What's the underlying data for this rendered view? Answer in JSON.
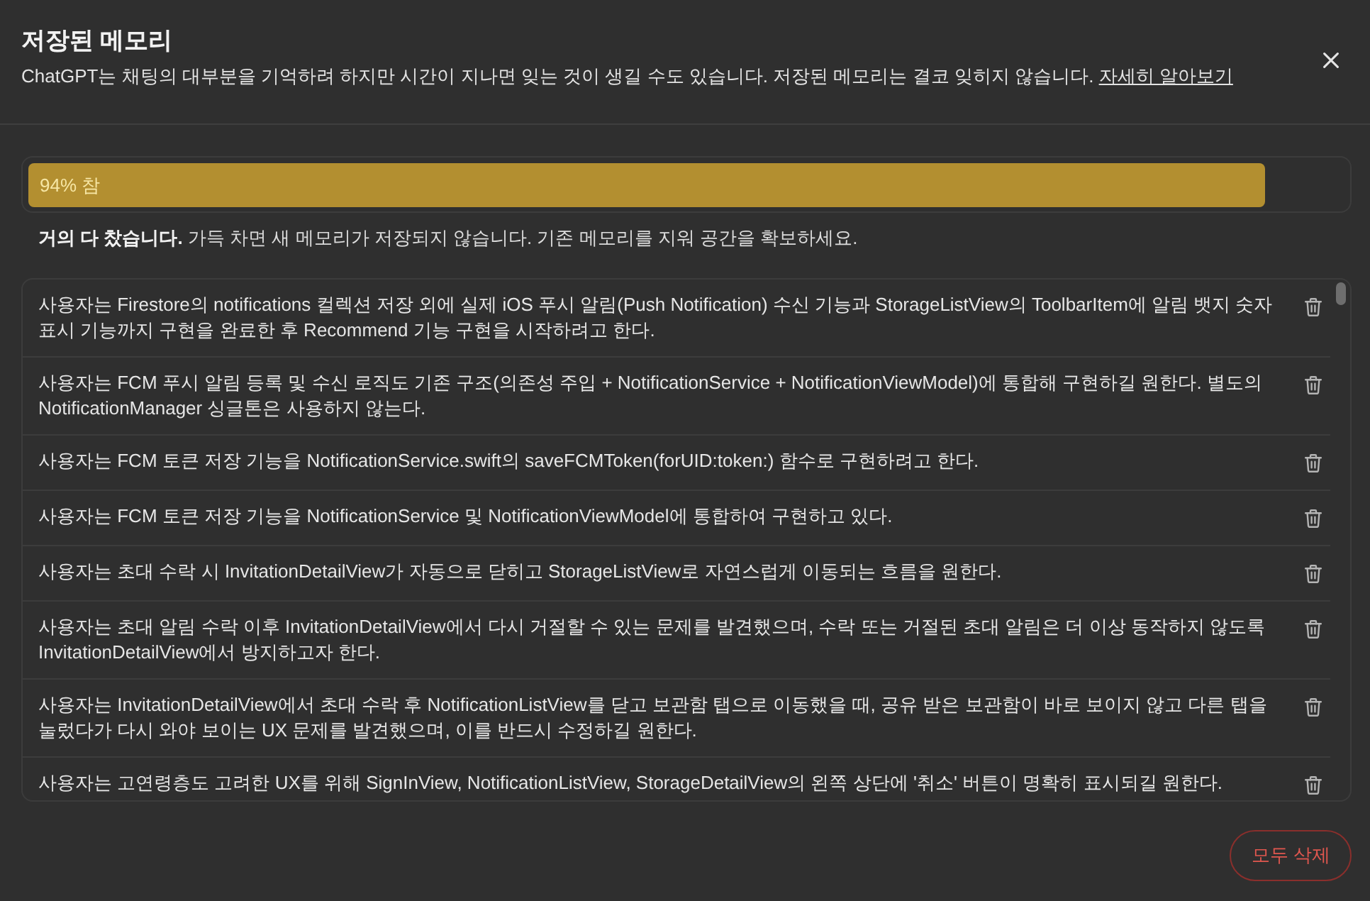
{
  "dialog": {
    "title": "저장된 메모리",
    "description": "ChatGPT는 채팅의 대부분을 기억하려 하지만 시간이 지나면 잊는 것이 생길 수도 있습니다. 저장된 메모리는 결코 잊히지 않습니다.",
    "link": "자세히 알아보기"
  },
  "usage": {
    "label": "94% 참",
    "level": 0.94,
    "note": "**거의 다 찼습니다.** 가득 차면 새 메모리가 저장되지 않습니다. 기존 메모리를 지워 공간을 확보하세요."
  },
  "memories": [
    {
      "text": "사용자는 Firestore의 notifications 컬렉션 저장 외에 실제 iOS 푸시 알림(Push Notification) 수신 기능과 StorageListView의 ToolbarItem에 알림 뱃지 숫자 표시 기능까지 구현을 완료한 후 Recommend 기능 구현을 시작하려고 한다."
    },
    {
      "text": "사용자는 FCM 푸시 알림 등록 및 수신 로직도 기존 구조(의존성 주입 + NotificationService + NotificationViewModel)에 통합해 구현하길 원한다. 별도의 NotificationManager 싱글톤은 사용하지 않는다."
    },
    {
      "text": "사용자는 FCM 토큰 저장 기능을 NotificationService.swift의 saveFCMToken(forUID:token:) 함수로 구현하려고 한다."
    },
    {
      "text": "사용자는 FCM 토큰 저장 기능을 NotificationService 및 NotificationViewModel에 통합하여 구현하고 있다."
    },
    {
      "text": "사용자는 초대 수락 시 InvitationDetailView가 자동으로 닫히고 StorageListView로 자연스럽게 이동되는 흐름을 원한다."
    },
    {
      "text": "사용자는 초대 알림 수락 이후 InvitationDetailView에서 다시 거절할 수 있는 문제를 발견했으며, 수락 또는 거절된 초대 알림은 더 이상 동작하지 않도록 InvitationDetailView에서 방지하고자 한다."
    },
    {
      "text": "사용자는 InvitationDetailView에서 초대 수락 후 NotificationListView를 닫고 보관함 탭으로 이동했을 때, 공유 받은 보관함이 바로 보이지 않고 다른 탭을 눌렀다가 다시 와야 보이는 UX 문제를 발견했으며, 이를 반드시 수정하길 원한다."
    },
    {
      "text": "사용자는 고연령층도 고려한 UX를 위해 SignInView, NotificationListView, StorageDetailView의 왼쪽 상단에 '취소' 버튼이 명확히 표시되길 원한다."
    }
  ],
  "buttons": {
    "delete_all": "모두 삭제"
  }
}
